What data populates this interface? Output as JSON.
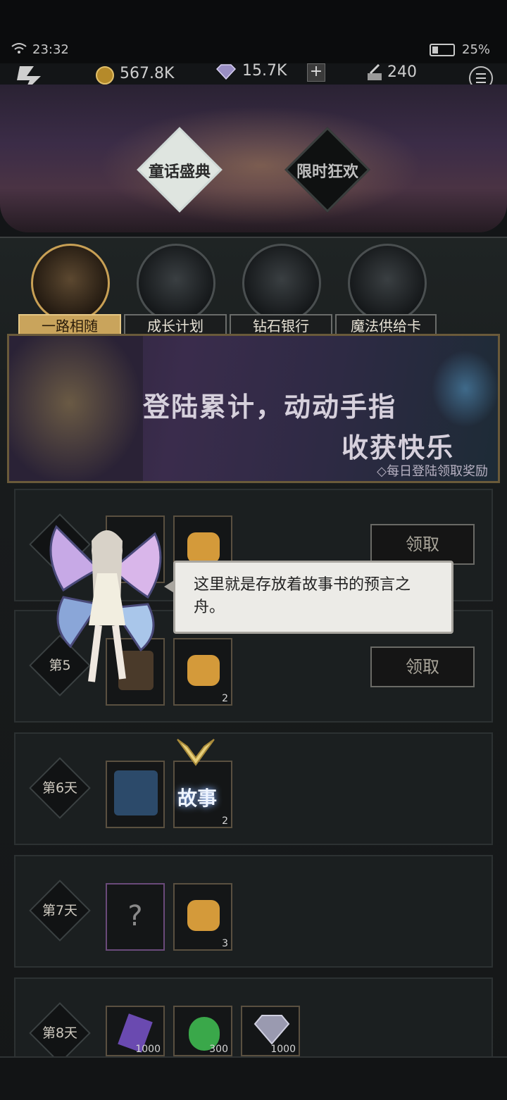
{
  "status": {
    "time": "23:32",
    "battery": "25%"
  },
  "currency": {
    "gold": "567.8K",
    "gems": "15.7K",
    "energy": "240"
  },
  "header_tabs": [
    {
      "label": "童话盛典"
    },
    {
      "label": "限时狂欢"
    }
  ],
  "categories": [
    {
      "label": "一路相随"
    },
    {
      "label": "成长计划"
    },
    {
      "label": "钻石银行"
    },
    {
      "label": "魔法供给卡"
    }
  ],
  "banner": {
    "line1": "登陆累计，动动手指",
    "line2": "收获快乐",
    "sub": "◇每日登陆领取奖励"
  },
  "dialog": {
    "text": "这里就是存放着故事书的预言之舟。"
  },
  "rows": [
    {
      "day": "第",
      "claim": "领取"
    },
    {
      "day": "第5",
      "claim": "领取",
      "item_count_2": "2"
    },
    {
      "day": "第6天",
      "item_count_2": "2",
      "story_label": "故事"
    },
    {
      "day": "第7天",
      "item_count_2": "3"
    },
    {
      "day": "第8天",
      "item_count_1": "1000",
      "item_count_2": "300",
      "item_count_3": "1000"
    }
  ],
  "colors": {
    "accent_gold": "#c9a45c",
    "frame": "#5a5040"
  }
}
